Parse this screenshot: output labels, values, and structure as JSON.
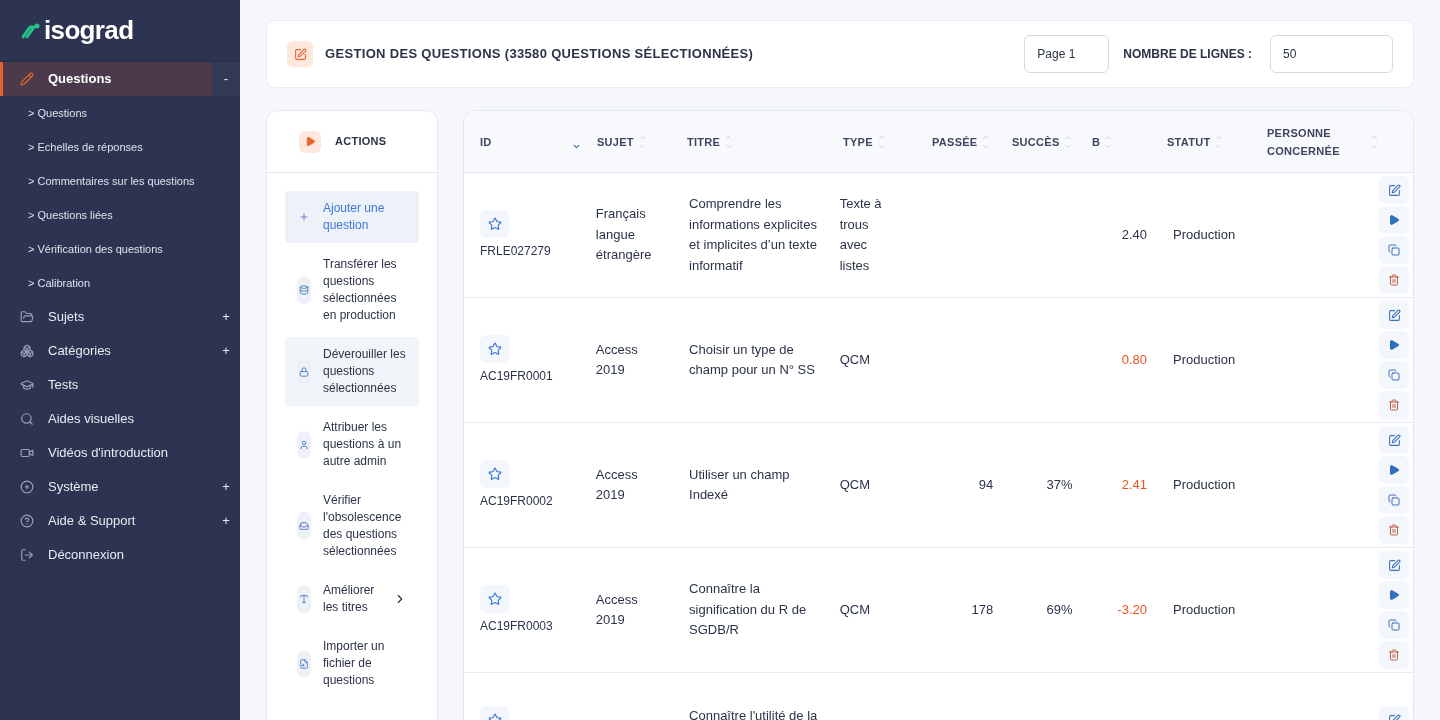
{
  "sidebar": {
    "logo": "isograd",
    "items": [
      {
        "label": "Questions",
        "toggle": "-",
        "selected": true,
        "expanded": true,
        "children": [
          {
            "label": "> Questions"
          },
          {
            "label": "> Echelles de réponses"
          },
          {
            "label": "> Commentaires sur les questions"
          },
          {
            "label": "> Questions liées"
          },
          {
            "label": "> Vérification des questions"
          },
          {
            "label": "> Calibration"
          }
        ]
      },
      {
        "label": "Sujets",
        "toggle": "+",
        "selected": false
      },
      {
        "label": "Catégories",
        "toggle": "+",
        "selected": false
      },
      {
        "label": "Tests",
        "selected": false
      },
      {
        "label": "Aides visuelles",
        "selected": false
      },
      {
        "label": "Vidéos d'introduction",
        "selected": false
      },
      {
        "label": "Système",
        "toggle": "+",
        "selected": false
      },
      {
        "label": "Aide & Support",
        "toggle": "+",
        "selected": false
      },
      {
        "label": "Déconnexion",
        "selected": false
      }
    ]
  },
  "header": {
    "title": "GESTION DES QUESTIONS (33580 QUESTIONS SÉLECTIONNÉES)",
    "page_field": {
      "value": "Page 1"
    },
    "rows_label": "NOMBRE DE LIGNES :",
    "rows_field": {
      "value": "50"
    }
  },
  "actions": {
    "title": "ACTIONS",
    "items": [
      {
        "label": "Ajouter une question",
        "selected": true
      },
      {
        "label": "Transférer les questions sélectionnées en production",
        "selected": false
      },
      {
        "label": "Déverouiller les questions sélectionnées",
        "selected": false,
        "hovered": true
      },
      {
        "label": "Attribuer les questions à un autre admin",
        "selected": false
      },
      {
        "label": "Vérifier l'obsolescence des questions sélectionnées",
        "selected": false
      },
      {
        "label": "Améliorer les titres",
        "selected": false,
        "has_submenu": true
      },
      {
        "label": "Importer un fichier de questions",
        "selected": false
      }
    ]
  },
  "table": {
    "columns": [
      {
        "label": "ID",
        "sorted": true
      },
      {
        "label": "SUJET",
        "sorted": false
      },
      {
        "label": "TITRE",
        "sorted": false
      },
      {
        "label": "TYPE",
        "sorted": false
      },
      {
        "label": "PASSÉE",
        "sorted": false
      },
      {
        "label": "SUCCÈS",
        "sorted": false
      },
      {
        "label": "B",
        "sorted": false
      },
      {
        "label": "STATUT",
        "sorted": false
      },
      {
        "label": "PERSONNE CONCERNÉE",
        "sorted": false
      }
    ],
    "rows": [
      {
        "starred": false,
        "id": "FRLE027279",
        "sujet": "Français langue étrangère",
        "titre": "Comprendre les informations explicites et implicites d’un texte informatif",
        "type": "Texte à trous avec listes",
        "b": "2.40",
        "b_flagged": false,
        "statut": "Production"
      },
      {
        "starred": false,
        "id": "AC19FR0001",
        "sujet": "Access 2019",
        "titre": "Choisir un type de champ pour un N° SS",
        "type": "QCM",
        "b": "0.80",
        "b_flagged": true,
        "statut": "Production"
      },
      {
        "starred": false,
        "id": "AC19FR0002",
        "sujet": "Access 2019",
        "titre": "Utiliser un champ Indexé",
        "type": "QCM",
        "passee": "94",
        "succes": "37%",
        "b": "2.41",
        "b_flagged": true,
        "statut": "Production"
      },
      {
        "starred": false,
        "id": "AC19FR0003",
        "sujet": "Access 2019",
        "titre": "Connaître la signification du R de SGDB/R",
        "type": "QCM",
        "passee": "178",
        "succes": "69%",
        "b": "-3.20",
        "b_flagged": true,
        "statut": "Production"
      },
      {
        "starred": false,
        "titre": "Connaître l'utilité de la"
      }
    ]
  }
}
